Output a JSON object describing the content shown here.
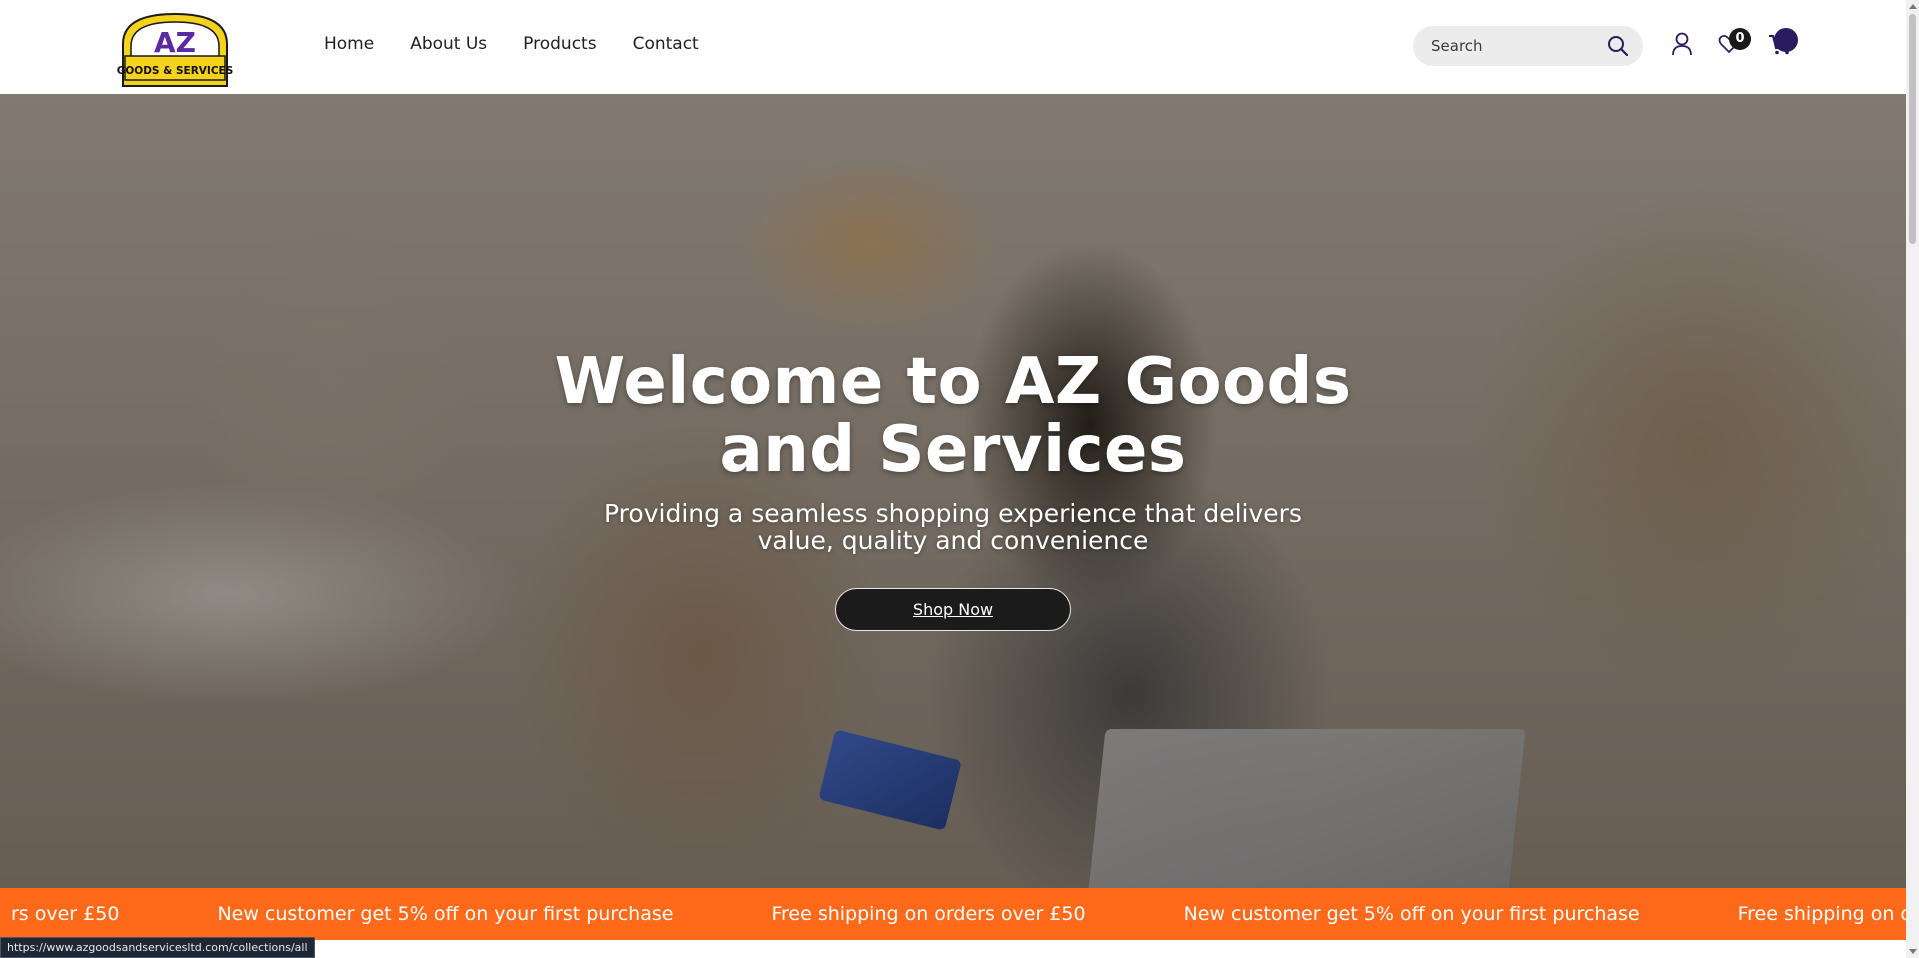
{
  "logo": {
    "line1": "AZ",
    "line2": "GOODS & SERVICES"
  },
  "nav": {
    "items": [
      "Home",
      "About Us",
      "Products",
      "Contact"
    ]
  },
  "search": {
    "placeholder": "Search"
  },
  "header_icons": {
    "account": "user-icon",
    "wishlist": "heart-icon",
    "wishlist_count": "0",
    "cart": "cart-icon"
  },
  "hero": {
    "title_line1": "Welcome to AZ Goods",
    "title_line2": "and Services",
    "subtitle_line1": "Providing a seamless shopping experience that delivers",
    "subtitle_line2": "value, quality and convenience",
    "cta": "Shop Now"
  },
  "ticker": {
    "items": [
      "rs over £50",
      "New customer get 5% off on your first purchase",
      "Free shipping on orders over £50",
      "New customer get 5% off on your first purchase",
      "Free shipping on orders over £"
    ]
  },
  "status_bar": {
    "url": "https://www.azgoodsandservicesltd.com/collections/all"
  },
  "colors": {
    "accent": "#ff6a1a",
    "cta_bg": "#1b1b1b",
    "logo_purple": "#5b2aa0",
    "logo_yellow": "#f5d31d"
  }
}
